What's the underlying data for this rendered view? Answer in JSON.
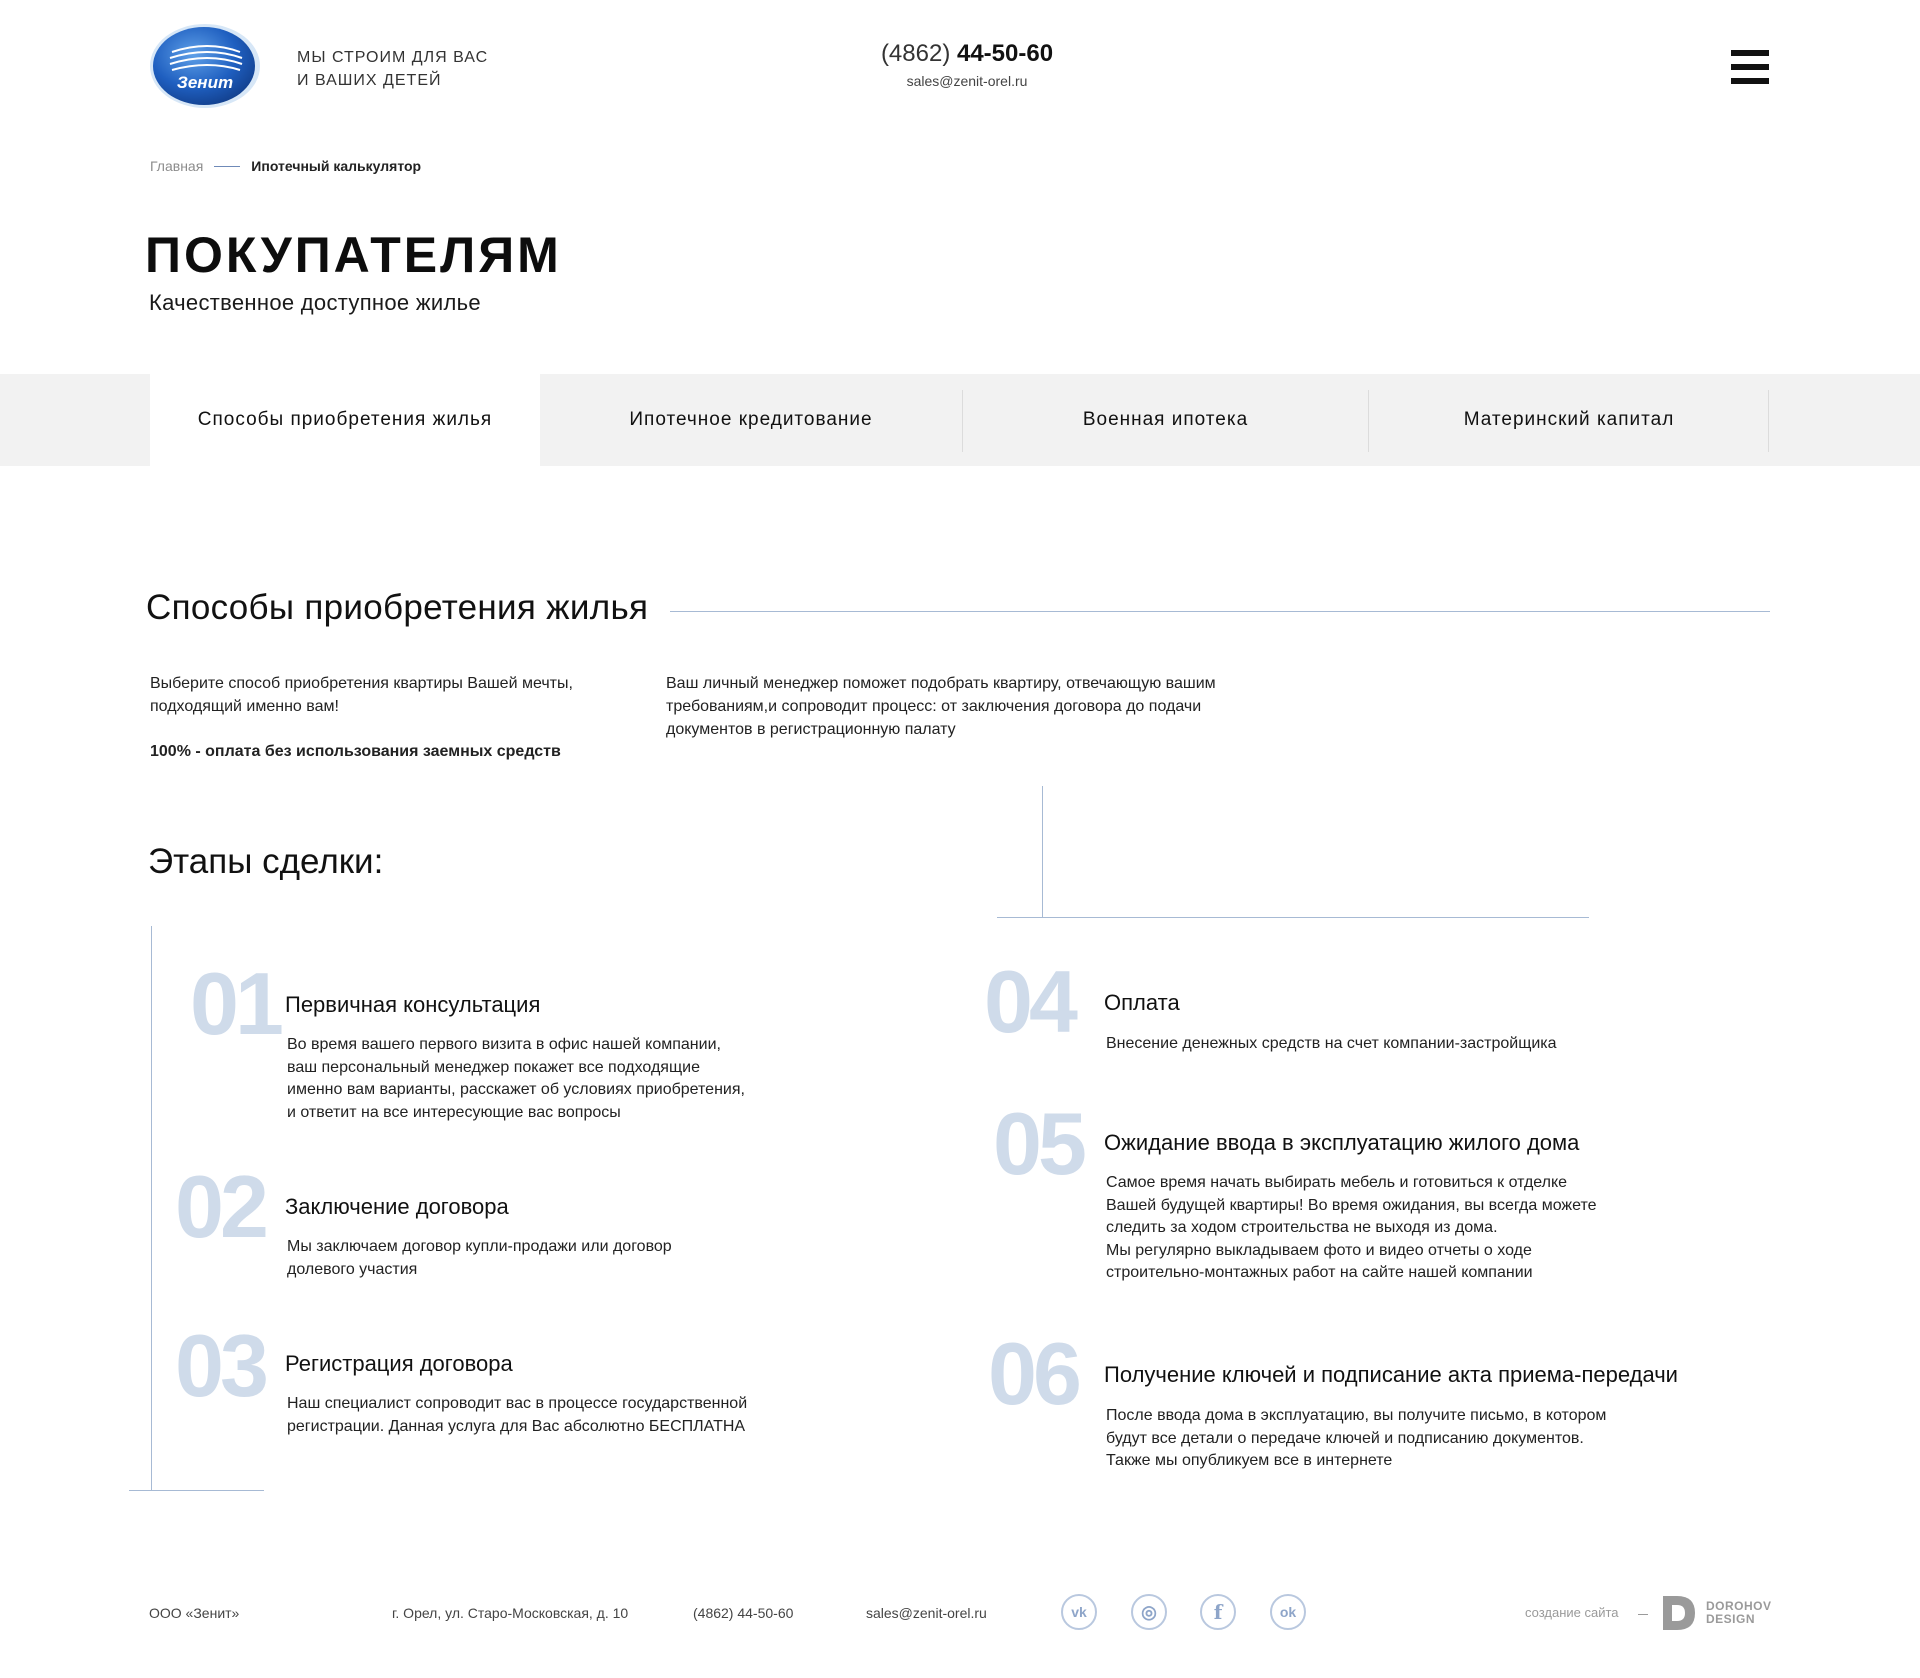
{
  "header": {
    "logo_text": "Зенит",
    "tagline_line1": "МЫ СТРОИМ ДЛЯ ВАС",
    "tagline_line2": "И ВАШИХ ДЕТЕЙ",
    "phone_code": "(4862)",
    "phone_number": "44-50-60",
    "email": "sales@zenit-orel.ru",
    "menu_icon": "hamburger-icon"
  },
  "breadcrumb": {
    "home": "Главная",
    "current": "Ипотечный калькулятор"
  },
  "page": {
    "title": "ПОКУПАТЕЛЯМ",
    "subtitle": "Качественное доступное жилье"
  },
  "tabs": [
    {
      "label": "Способы приобретения жилья",
      "active": true
    },
    {
      "label": "Ипотечное кредитование",
      "active": false
    },
    {
      "label": "Военная ипотека",
      "active": false
    },
    {
      "label": "Материнский капитал",
      "active": false
    }
  ],
  "section": {
    "title": "Способы приобретения жилья",
    "intro_left": "Выберите способ приобретения квартиры Вашей мечты, подходящий именно вам!",
    "intro_left_bold": "100% - оплата без использования заемных средств",
    "intro_right": "Ваш личный менеджер поможет подобрать квартиру, отвечающую вашим требованиям,и сопроводит процесс: от заключения договора до подачи документов в регистрационную палату"
  },
  "stages": {
    "title": "Этапы сделки:",
    "steps": [
      {
        "num": "01",
        "title": "Первичная консультация",
        "text": "Во время вашего первого визита в офис нашей компании,\nваш персональный менеджер покажет все подходящие\nименно вам варианты, расскажет об условиях приобретения,\nи ответит на все интересующие вас вопросы"
      },
      {
        "num": "02",
        "title": "Заключение договора",
        "text": "Мы заключаем договор купли-продажи или договор\nдолевого участия"
      },
      {
        "num": "03",
        "title": "Регистрация договора",
        "text": "Наш специалист сопроводит вас в процессе государственной\nрегистрации. Данная услуга для Вас абсолютно БЕСПЛАТНА"
      },
      {
        "num": "04",
        "title": "Оплата",
        "text": "Внесение денежных средств на счет компании-застройщика"
      },
      {
        "num": "05",
        "title": "Ожидание ввода в эксплуатацию жилого дома",
        "text": "Самое время начать выбирать мебель и готовиться к отделке\nВашей будущей квартиры! Во время ожидания, вы всегда можете\nследить за ходом строительства не выходя из дома.\nМы регулярно выкладываем фото и видео отчеты о ходе\nстроительно-монтажных работ на сайте нашей компании"
      },
      {
        "num": "06",
        "title": "Получение ключей и подписание акта приема-передачи",
        "text": "После ввода дома в эксплуатацию, вы получите письмо, в котором\nбудут все детали о передаче ключей и подписанию документов.\nТакже мы опубликуем все в интернете"
      }
    ]
  },
  "footer": {
    "company": "ООО «Зенит»",
    "address": "г. Орел, ул. Старо-Московская, д. 10",
    "phone": "(4862) 44-50-60",
    "email": "sales@zenit-orel.ru",
    "socials": [
      {
        "icon": "vk-icon",
        "glyph": "vk"
      },
      {
        "icon": "instagram-icon",
        "glyph": "◎"
      },
      {
        "icon": "facebook-icon",
        "glyph": "f"
      },
      {
        "icon": "odnoklassniki-icon",
        "glyph": "ok"
      }
    ],
    "made_by": "создание сайта",
    "studio_line1": "DOROHOV",
    "studio_line2": "DESIGN"
  },
  "colors": {
    "accent_line": "#a7bad4",
    "step_number": "#cfdbea",
    "tabs_bg": "#f2f2f2",
    "logo_blue": "#1a4fa8"
  }
}
